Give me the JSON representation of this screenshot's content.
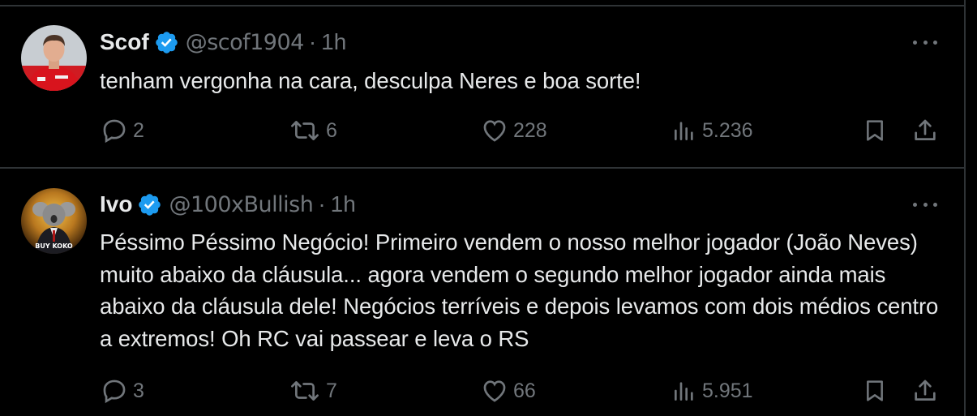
{
  "tweets": [
    {
      "name": "Scof",
      "handle": "@scof1904",
      "separator": "·",
      "time": "1h",
      "text": "tenham vergonha na cara, desculpa Neres e boa sorte!",
      "replies": "2",
      "reposts": "6",
      "likes": "228",
      "views": "5.236"
    },
    {
      "name": "Ivo",
      "handle": "@100xBullish",
      "separator": "·",
      "time": "1h",
      "text": "Péssimo Péssimo Negócio! Primeiro vendem o nosso melhor jogador (João Neves) muito abaixo da cláusula... agora vendem o segundo melhor jogador ainda mais abaixo da cláusula dele! Negócios terríveis e depois levamos com dois médios centro a extremos! Oh RC vai passear e leva o RS",
      "replies": "3",
      "reposts": "7",
      "likes": "66",
      "views": "5.951",
      "avatar_caption": "BUY KOKO"
    }
  ],
  "colors": {
    "background": "#000000",
    "text": "#e7e9ea",
    "muted": "#71767b",
    "border": "#2f3336",
    "verified": "#1d9bf0"
  }
}
